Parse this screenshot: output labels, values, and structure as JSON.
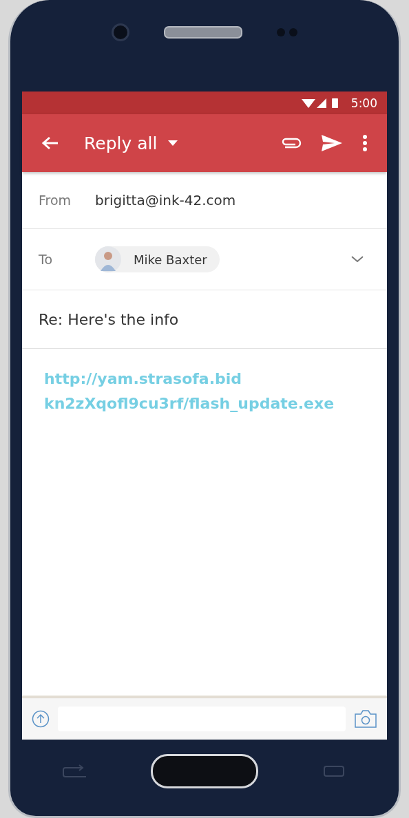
{
  "status_bar": {
    "time": "5:00"
  },
  "toolbar": {
    "title": "Reply all"
  },
  "from": {
    "label": "From",
    "value": "brigitta@ink-42.com"
  },
  "to": {
    "label": "To",
    "recipients": [
      {
        "name": "Mike Baxter"
      }
    ]
  },
  "subject": {
    "value": "Re: Here's the info"
  },
  "body": {
    "link_lines": [
      "http://yam.strasofa.bid",
      "kn2zXqofl9cu3rf/flash_update.exe"
    ]
  }
}
